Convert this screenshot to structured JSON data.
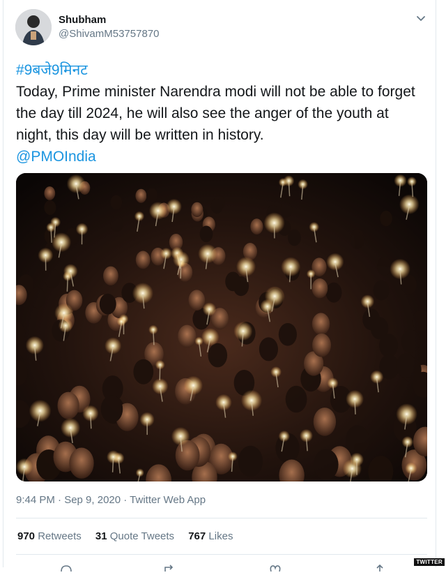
{
  "tweet": {
    "display_name": "Shubham",
    "handle": "@ShivamM53757870",
    "hashtag": "#9बजे9मिनट",
    "text_line": "Today, Prime minister Narendra modi will not be able to forget the day till 2024, he will also see the anger of the youth at night, this day will be written in history.",
    "mention": "@PMOIndia",
    "timestamp": "9:44 PM · Sep 9, 2020 · Twitter Web App",
    "stats": {
      "retweets_count": "970",
      "retweets_label": "Retweets",
      "quotes_count": "31",
      "quotes_label": "Quote Tweets",
      "likes_count": "767",
      "likes_label": "Likes"
    }
  },
  "icons": {
    "menu": "chevron-down-icon",
    "reply": "reply-icon",
    "retweet": "retweet-icon",
    "like": "heart-icon",
    "share": "share-icon"
  },
  "colors": {
    "link": "#1b95e0",
    "secondary_text": "#657786",
    "primary_text": "#14171a",
    "divider": "#e1e8ed"
  },
  "watermark": "TWITTER"
}
